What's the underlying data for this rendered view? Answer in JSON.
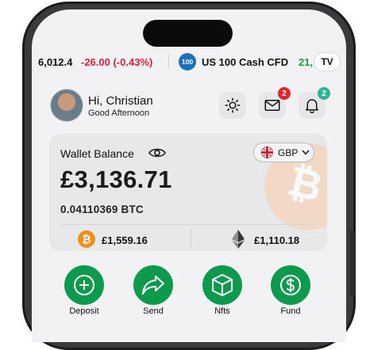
{
  "ticker": {
    "prev_price": "6,012.4",
    "prev_change": "-26.00 (-0.43%)",
    "index_badge": "100",
    "index_name": "US 100 Cash CFD",
    "next_price": "21,",
    "tv_logo": "TV"
  },
  "header": {
    "greeting": "Hi, Christian",
    "subgreeting": "Good Afternoon",
    "mail_badge": "2",
    "bell_badge": "2"
  },
  "wallet": {
    "label": "Wallet Balance",
    "currency": "GBP",
    "balance": "£3,136.71",
    "btc_amount": "0.04110369 BTC",
    "btc_holding": "£1,559.16",
    "eth_holding": "£1,110.18"
  },
  "actions": [
    {
      "label": "Deposit",
      "icon": "plus-icon"
    },
    {
      "label": "Send",
      "icon": "send-arrow-icon"
    },
    {
      "label": "Nfts",
      "icon": "cube-icon"
    },
    {
      "label": "Fund",
      "icon": "dollar-icon"
    }
  ],
  "colors": {
    "accent_green": "#0d9a4c",
    "negative_red": "#d6213b",
    "positive_green": "#1b9b4a",
    "mail_badge": "#e0252d",
    "bell_badge": "#2bb795",
    "btc_orange": "#ef8f1a"
  }
}
